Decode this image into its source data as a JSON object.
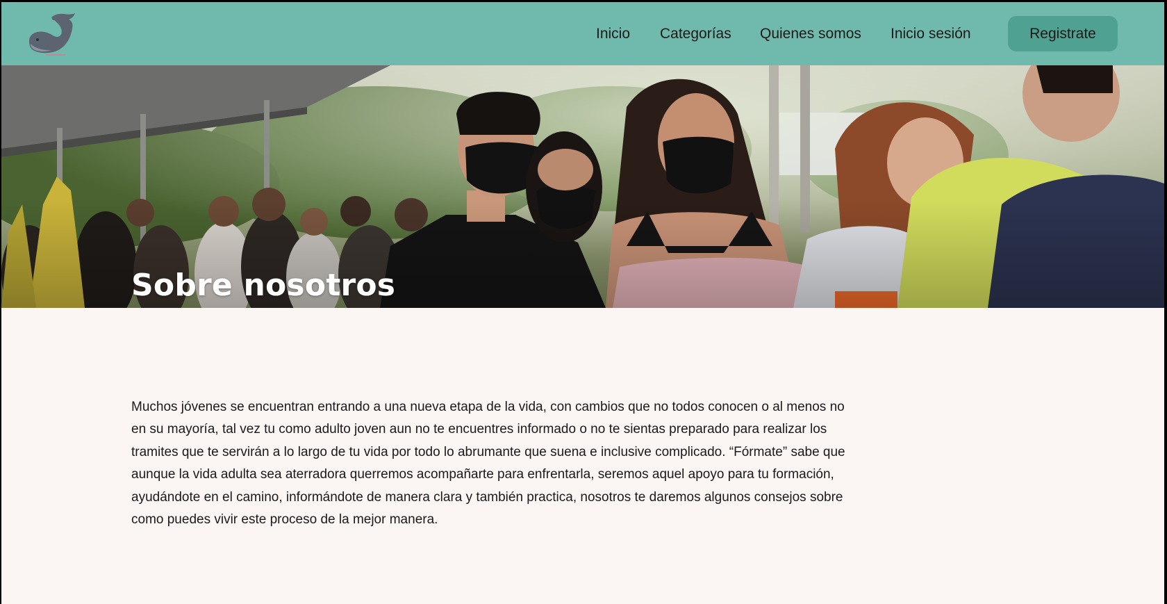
{
  "header": {
    "logo_icon": "whale-logo-icon",
    "nav": [
      {
        "label": "Inicio"
      },
      {
        "label": "Categorías"
      },
      {
        "label": "Quienes somos"
      },
      {
        "label": "Inicio sesión"
      }
    ],
    "register_label": "Registrate",
    "colors": {
      "bar": "#6fbaad",
      "button": "#4fa292"
    }
  },
  "hero": {
    "title": "Sobre nosotros",
    "image": "photo-young-people-wearing-face-masks-in-line"
  },
  "about": {
    "paragraph": "Muchos jóvenes se encuentran entrando a una nueva etapa de la vida, con cambios que no todos conocen o al menos no en su mayoría, tal vez tu como adulto joven aun no te encuentres informado o no te sientas preparado para realizar los tramites que te servirán a lo largo de tu vida por todo lo abrumante que suena e inclusive complicado. “Fórmate” sabe que aunque la vida adulta sea aterradora querremos acompañarte para enfrentarla, seremos aquel apoyo para tu formación, ayudándote en el camino, informándote de manera clara y también practica, nosotros te daremos algunos consejos sobre como puedes vivir este proceso de la mejor manera."
  }
}
